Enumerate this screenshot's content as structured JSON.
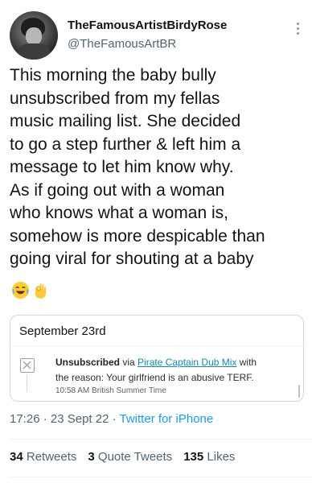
{
  "author": {
    "display_name": "TheFamousArtistBirdyRose",
    "handle": "@TheFamousArtBR"
  },
  "tweet": {
    "text": "This morning the baby bully\nunsubscribed from my fellas\nmusic mailing list. She decided\nto go a step further & left him a\nmessage to let him know why.\nAs if going out with a woman\nwho knows what a woman is,\nsomehow is more despicable than\ngoing viral for shouting at a baby",
    "emojis": [
      "face-with-tears-of-joy-icon",
      "ok-hand-icon"
    ]
  },
  "embedded_card": {
    "date": "September 23rd",
    "action_bold": "Unsubscribed",
    "via_text": " via ",
    "list_name": "Pirate Captain Dub Mix",
    "with_text": " with",
    "reason": "the reason: Your girlfriend is an abusive TERF.",
    "time": "10:58 AM British Summer Time",
    "icon": "close-box-icon"
  },
  "meta": {
    "time": "17:26",
    "dot1": " · ",
    "date": "23 Sept 22",
    "dot2": " · ",
    "source": "Twitter for iPhone"
  },
  "stats": {
    "retweets_count": "34",
    "retweets_label": "Retweets",
    "quotes_count": "3",
    "quotes_label": "Quote Tweets",
    "likes_count": "135",
    "likes_label": "Likes"
  },
  "colors": {
    "accent": "#1d9bf0",
    "secondary_text": "#536471",
    "primary_text": "#0f1419",
    "link_in_card": "#1a86a8"
  }
}
